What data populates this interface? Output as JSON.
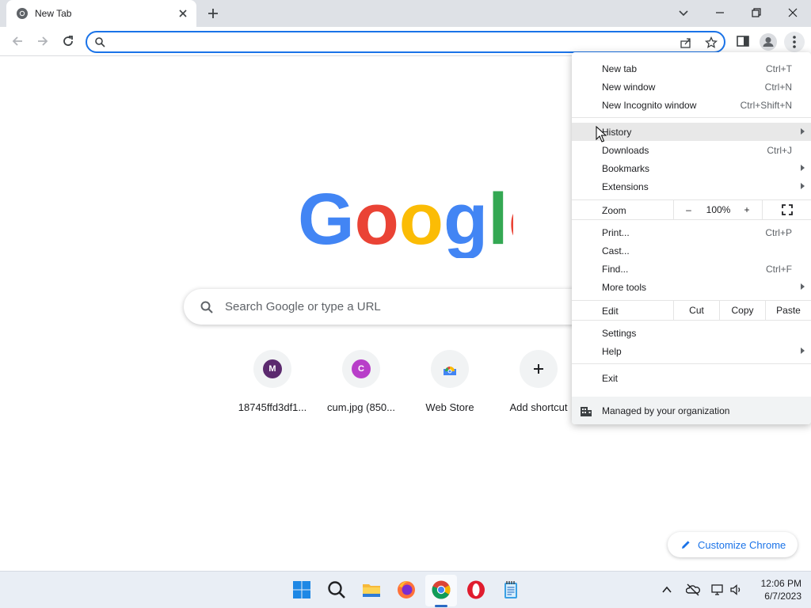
{
  "tab": {
    "title": "New Tab"
  },
  "omnibox": {
    "value": "",
    "placeholder": ""
  },
  "ntp": {
    "search_placeholder": "Search Google or type a URL",
    "shortcuts": [
      {
        "letter": "M",
        "label": "18745ffd3df1...",
        "color": "#5b2a6e"
      },
      {
        "letter": "C",
        "label": "cum.jpg (850...",
        "color": "#b83ec9"
      },
      {
        "letter": "",
        "label": "Web Store",
        "color": ""
      },
      {
        "letter": "+",
        "label": "Add shortcut",
        "color": ""
      }
    ],
    "customize_label": "Customize Chrome"
  },
  "menu": {
    "new_tab": {
      "label": "New tab",
      "shortcut": "Ctrl+T"
    },
    "new_window": {
      "label": "New window",
      "shortcut": "Ctrl+N"
    },
    "incognito": {
      "label": "New Incognito window",
      "shortcut": "Ctrl+Shift+N"
    },
    "history": {
      "label": "History"
    },
    "downloads": {
      "label": "Downloads",
      "shortcut": "Ctrl+J"
    },
    "bookmarks": {
      "label": "Bookmarks"
    },
    "extensions": {
      "label": "Extensions"
    },
    "zoom": {
      "label": "Zoom",
      "minus": "–",
      "level": "100%",
      "plus": "+"
    },
    "print": {
      "label": "Print...",
      "shortcut": "Ctrl+P"
    },
    "cast": {
      "label": "Cast..."
    },
    "find": {
      "label": "Find...",
      "shortcut": "Ctrl+F"
    },
    "more_tools": {
      "label": "More tools"
    },
    "edit": {
      "label": "Edit",
      "cut": "Cut",
      "copy": "Copy",
      "paste": "Paste"
    },
    "settings": {
      "label": "Settings"
    },
    "help": {
      "label": "Help"
    },
    "exit": {
      "label": "Exit"
    },
    "managed": "Managed by your organization"
  },
  "taskbar": {
    "time": "12:06 PM",
    "date": "6/7/2023"
  },
  "colors": {
    "accent": "#1a73e8",
    "google_blue": "#4285f4",
    "google_red": "#ea4335",
    "google_yellow": "#fbbc05",
    "google_green": "#34a853"
  }
}
